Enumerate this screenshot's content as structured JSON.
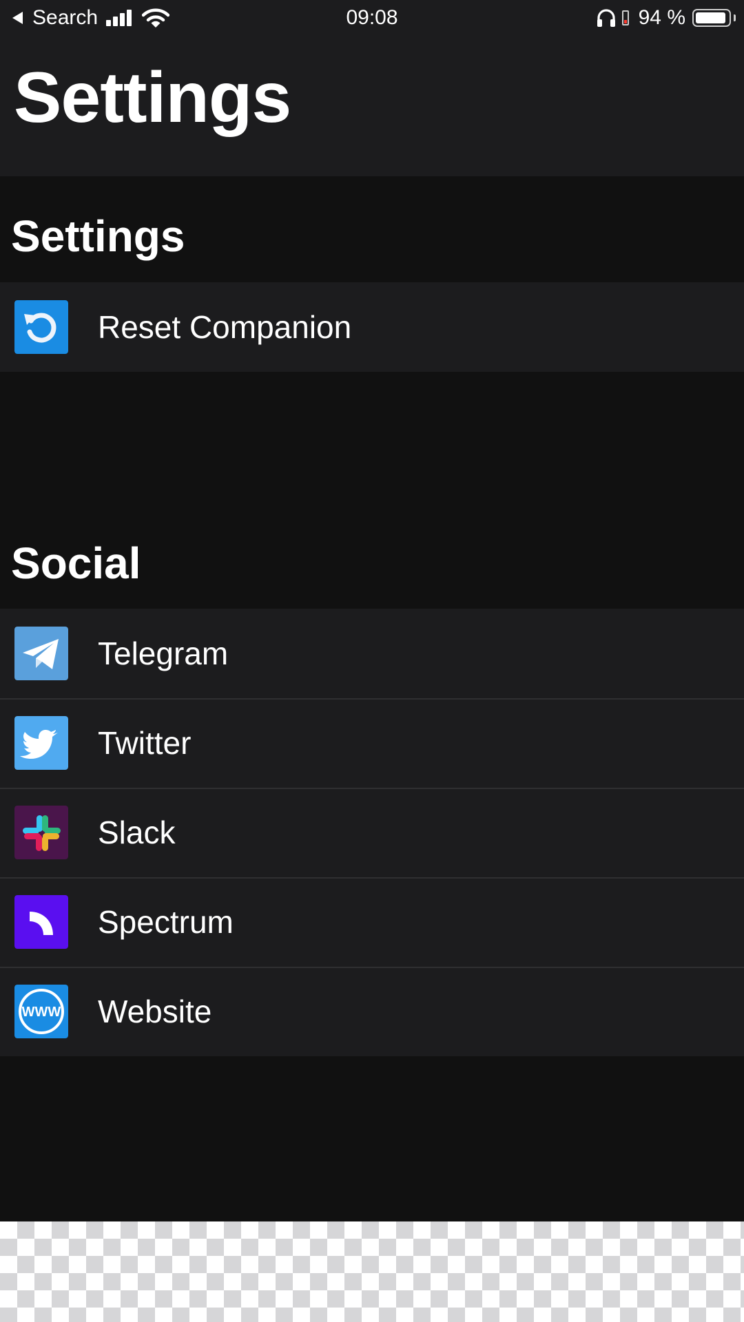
{
  "status_bar": {
    "back_label": "Search",
    "time": "09:08",
    "battery_percent": "94 %",
    "battery_level": 0.94,
    "icons": [
      "back-arrow-icon",
      "cellular-signal-icon",
      "wifi-icon",
      "headphones-icon",
      "low-battery-icon",
      "battery-icon"
    ]
  },
  "header": {
    "title": "Settings"
  },
  "sections": {
    "settings": {
      "title": "Settings",
      "items": [
        {
          "label": "Reset Companion",
          "icon": "reset-icon",
          "icon_color": "#1a8ce3"
        }
      ]
    },
    "social": {
      "title": "Social",
      "items": [
        {
          "label": "Telegram",
          "icon": "telegram-icon",
          "icon_color": "#5aa0dc"
        },
        {
          "label": "Twitter",
          "icon": "twitter-icon",
          "icon_color": "#50aaf0"
        },
        {
          "label": "Slack",
          "icon": "slack-icon",
          "icon_color": "#4a154b"
        },
        {
          "label": "Spectrum",
          "icon": "spectrum-icon",
          "icon_color": "#5a0ff0"
        },
        {
          "label": "Website",
          "icon": "website-icon",
          "icon_color": "#1a8ce3",
          "icon_text": "WWW"
        }
      ]
    }
  }
}
